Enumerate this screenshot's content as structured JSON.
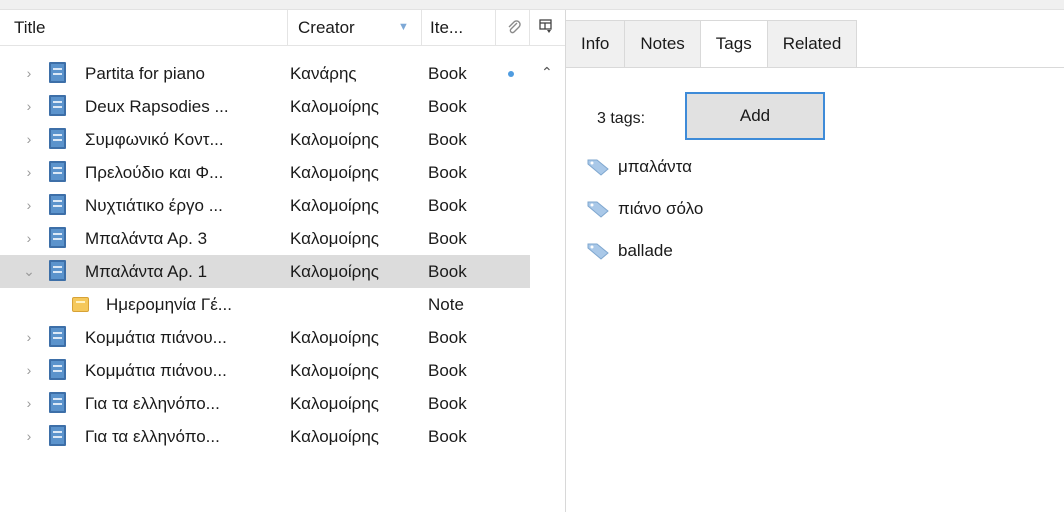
{
  "columns": {
    "title": "Title",
    "creator": "Creator",
    "item_type": "Ite...",
    "attachments_icon": "paperclip-icon",
    "column_picker_icon": "column-picker-icon"
  },
  "rows": [
    {
      "title": "Partita for piano",
      "creator": "Κανάρης",
      "type": "Book",
      "expanded": false,
      "has_attachment_dot": true
    },
    {
      "title": "Deux Rapsodies  ...",
      "creator": "Καλομοίρης",
      "type": "Book",
      "expanded": false
    },
    {
      "title": "Συμφωνικό Κοντ...",
      "creator": "Καλομοίρης",
      "type": "Book",
      "expanded": false
    },
    {
      "title": "Πρελούδιο και Φ...",
      "creator": "Καλομοίρης",
      "type": "Book",
      "expanded": false
    },
    {
      "title": "Νυχτιάτικο έργο ...",
      "creator": "Καλομοίρης",
      "type": "Book",
      "expanded": false
    },
    {
      "title": "Μπαλάντα Αρ. 3",
      "creator": "Καλομοίρης",
      "type": "Book",
      "expanded": false
    },
    {
      "title": "Μπαλάντα Αρ. 1",
      "creator": "Καλομοίρης",
      "type": "Book",
      "expanded": true,
      "selected": true
    },
    {
      "title": "Ημερομηνία Γέ...",
      "creator": "",
      "type": "Note",
      "child": true
    },
    {
      "title": "Κομμάτια πιάνου...",
      "creator": "Καλομοίρης",
      "type": "Book",
      "expanded": false
    },
    {
      "title": "Κομμάτια πιάνου...",
      "creator": "Καλομοίρης",
      "type": "Book",
      "expanded": false
    },
    {
      "title": "Για τα ελληνόπο...",
      "creator": "Καλομοίρης",
      "type": "Book",
      "expanded": false
    },
    {
      "title": "Για τα ελληνόπο...",
      "creator": "Καλομοίρης",
      "type": "Book",
      "expanded": false
    }
  ],
  "tabs": [
    {
      "label": "Info"
    },
    {
      "label": "Notes"
    },
    {
      "label": "Tags",
      "active": true
    },
    {
      "label": "Related"
    }
  ],
  "tags_pane": {
    "count_label": "3 tags:",
    "add_label": "Add",
    "tags": [
      "μπαλάντα",
      "πιάνο σόλο",
      "ballade"
    ]
  },
  "colors": {
    "accent": "#3e8bd8",
    "selected_row": "#dcdcdc",
    "book_icon": "#5b93cc",
    "note_icon": "#f5c85b",
    "tag_icon": "#a9c8e8"
  }
}
